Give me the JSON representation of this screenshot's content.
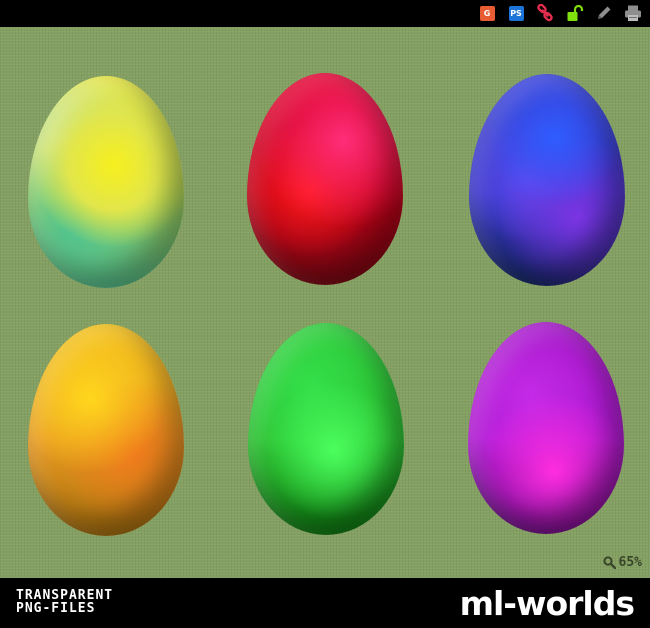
{
  "toolbar": {
    "items": [
      {
        "name": "google-search-icon",
        "label": "G",
        "color": "#e85c33"
      },
      {
        "name": "photoshop-icon",
        "label": "PS",
        "color": "#1c73d8"
      },
      {
        "name": "link-icon",
        "color": "#e32d4e"
      },
      {
        "name": "unlock-icon",
        "color": "#7fe00c"
      },
      {
        "name": "edit-pencil-icon",
        "color": "#8e8e8e"
      },
      {
        "name": "print-icon",
        "color": "#8e8e8e"
      }
    ]
  },
  "zoom": {
    "value": "65%"
  },
  "footer": {
    "line1": "TRANSPARENT",
    "line2": "PNG-FILES",
    "brand": "ml-worlds"
  },
  "eggs": [
    {
      "name": "egg-yellow",
      "colors": [
        "#f0ec2a",
        "#9fd05a",
        "#55c38a"
      ]
    },
    {
      "name": "egg-red",
      "colors": [
        "#ff1e66",
        "#e7001e",
        "#8f0914"
      ]
    },
    {
      "name": "egg-blue",
      "colors": [
        "#3f55ff",
        "#4a2fcf",
        "#13276a"
      ]
    },
    {
      "name": "egg-orange",
      "colors": [
        "#ffd21e",
        "#f08d18",
        "#a86f0e"
      ]
    },
    {
      "name": "egg-green",
      "colors": [
        "#47ff58",
        "#26c42a",
        "#0f7d11"
      ]
    },
    {
      "name": "egg-purple",
      "colors": [
        "#f02ce8",
        "#b01ad0",
        "#60087a"
      ]
    }
  ]
}
